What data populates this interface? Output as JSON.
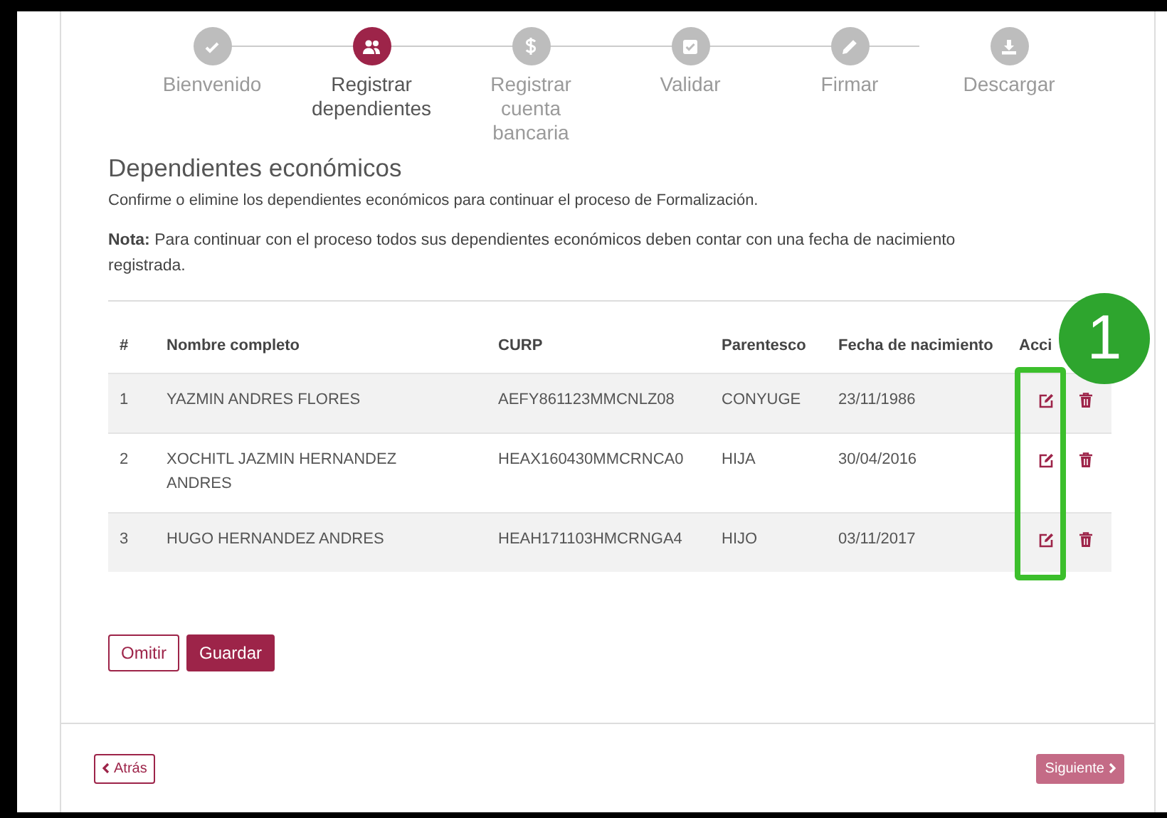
{
  "steps": [
    {
      "label": "Bienvenido",
      "selected": false
    },
    {
      "label": "Registrar dependientes",
      "selected": true
    },
    {
      "label": "Registrar cuenta bancaria",
      "selected": false
    },
    {
      "label": "Validar",
      "selected": false
    },
    {
      "label": "Firmar",
      "selected": false
    },
    {
      "label": "Descargar",
      "selected": false
    }
  ],
  "section": {
    "title": "Dependientes económicos",
    "intro": "Confirme o elimine los dependientes económicos para continuar el proceso de Formalización.",
    "note": "**Nota:** Para continuar con el proceso todos sus dependientes económicos deben contar con una fecha de nacimiento registrada."
  },
  "table": {
    "columns": [
      "#",
      "Nombre completo",
      "CURP",
      "Parentesco",
      "Fecha de nacimiento",
      "Acci"
    ],
    "rows": [
      {
        "cells": [
          "1",
          "YAZMIN ANDRES FLORES",
          "AEFY861123MMCNLZ08",
          "CONYUGE",
          "23/11/1986"
        ]
      },
      {
        "cells": [
          "2",
          "XOCHITL JAZMIN HERNANDEZ ANDRES",
          "HEAX160430MMCRNCA0",
          "HIJA",
          "30/04/2016"
        ]
      },
      {
        "cells": [
          "3",
          "HUGO HERNANDEZ ANDRES",
          "HEAH171103HMCRNGA4",
          "HIJO",
          "03/11/2017"
        ]
      }
    ]
  },
  "buttons": [
    {
      "label": "Omitir",
      "kind": "outline"
    },
    {
      "label": "Guardar",
      "kind": "filled"
    }
  ],
  "nav": {
    "back": "Atrás",
    "next": "Siguiente"
  },
  "annotation": {
    "label": "1"
  }
}
